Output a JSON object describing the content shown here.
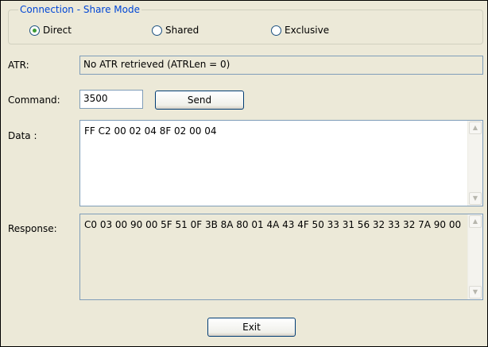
{
  "share_mode": {
    "title": "Connection - Share Mode",
    "options": [
      {
        "label": "Direct",
        "selected": true
      },
      {
        "label": "Shared",
        "selected": false
      },
      {
        "label": "Exclusive",
        "selected": false
      }
    ]
  },
  "atr": {
    "label": "ATR:",
    "value": "No ATR retrieved (ATRLen = 0)"
  },
  "command": {
    "label": "Command:",
    "value": "3500",
    "send_label": "Send"
  },
  "data_field": {
    "label": "Data :",
    "value": "FF C2 00 02 04 8F 02 00 04"
  },
  "response": {
    "label": "Response:",
    "value": "C0 03 00 90 00 5F 51 0F 3B 8A 80 01 4A 43 4F 50 33 31 56 32 33 32 7A 90 00"
  },
  "exit_label": "Exit",
  "icons": {
    "scroll_up": "scroll-up-arrow",
    "scroll_down": "scroll-down-arrow",
    "radio": "radio-button"
  }
}
